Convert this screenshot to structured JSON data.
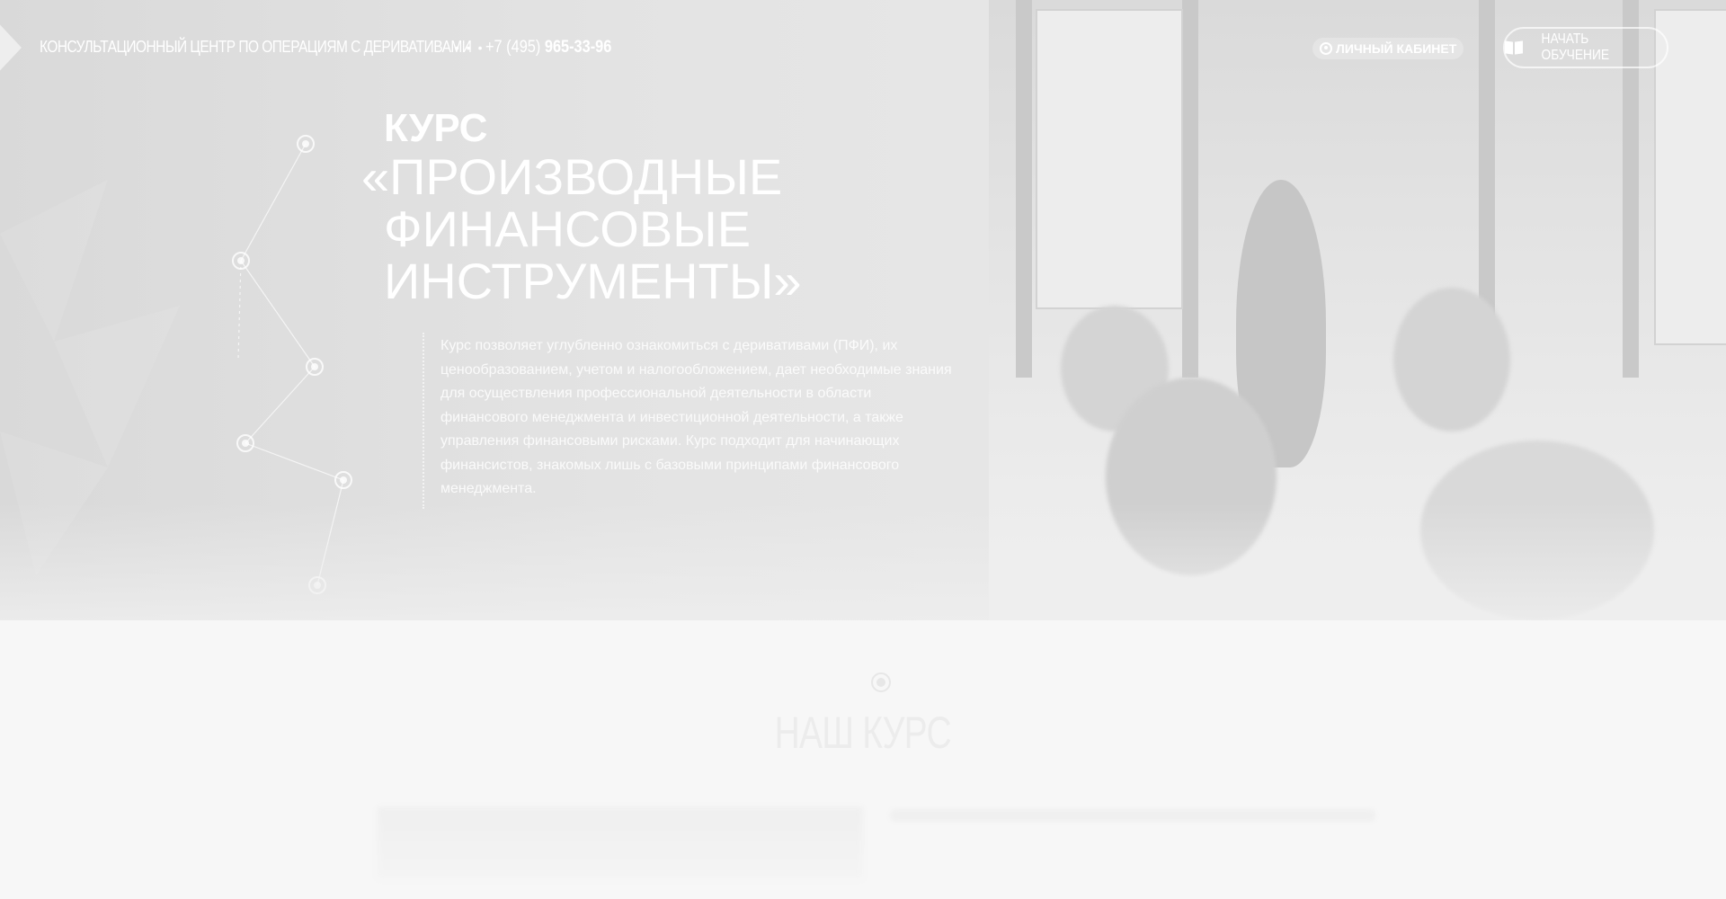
{
  "header": {
    "title": "Консультационный центр по операциям с деривативами",
    "dots": "• • •",
    "phone_prefix": "+7 (495) ",
    "phone_number": "965-33-96",
    "cabinet_label": "Личный кабинет",
    "start_label": "Начать обучение"
  },
  "hero": {
    "kurs_label": "КУРС",
    "title_lines": [
      "«ПРОИЗВОДНЫЕ",
      "ФИНАНСОВЫЕ",
      "ИНСТРУМЕНТЫ»"
    ],
    "description": "Курс позволяет углубленно ознакомиться с деривативами (ПФИ), их ценообразованием, учетом и налогообложением, дает необходимые знания для осуществления профессиональной деятельности в области финансового менеджмента и инвестиционной деятельности, а также управления финансовыми рисками. Курс подходит для начинающих финансистов, знакомых лишь с базовыми принципами финансового менеджмента."
  },
  "section": {
    "title": "Наш курс"
  },
  "icons": {
    "logo": "logo-hexagon-icon",
    "cabinet": "user-circle-icon",
    "start": "open-book-icon",
    "section": "circle-dot-icon"
  }
}
